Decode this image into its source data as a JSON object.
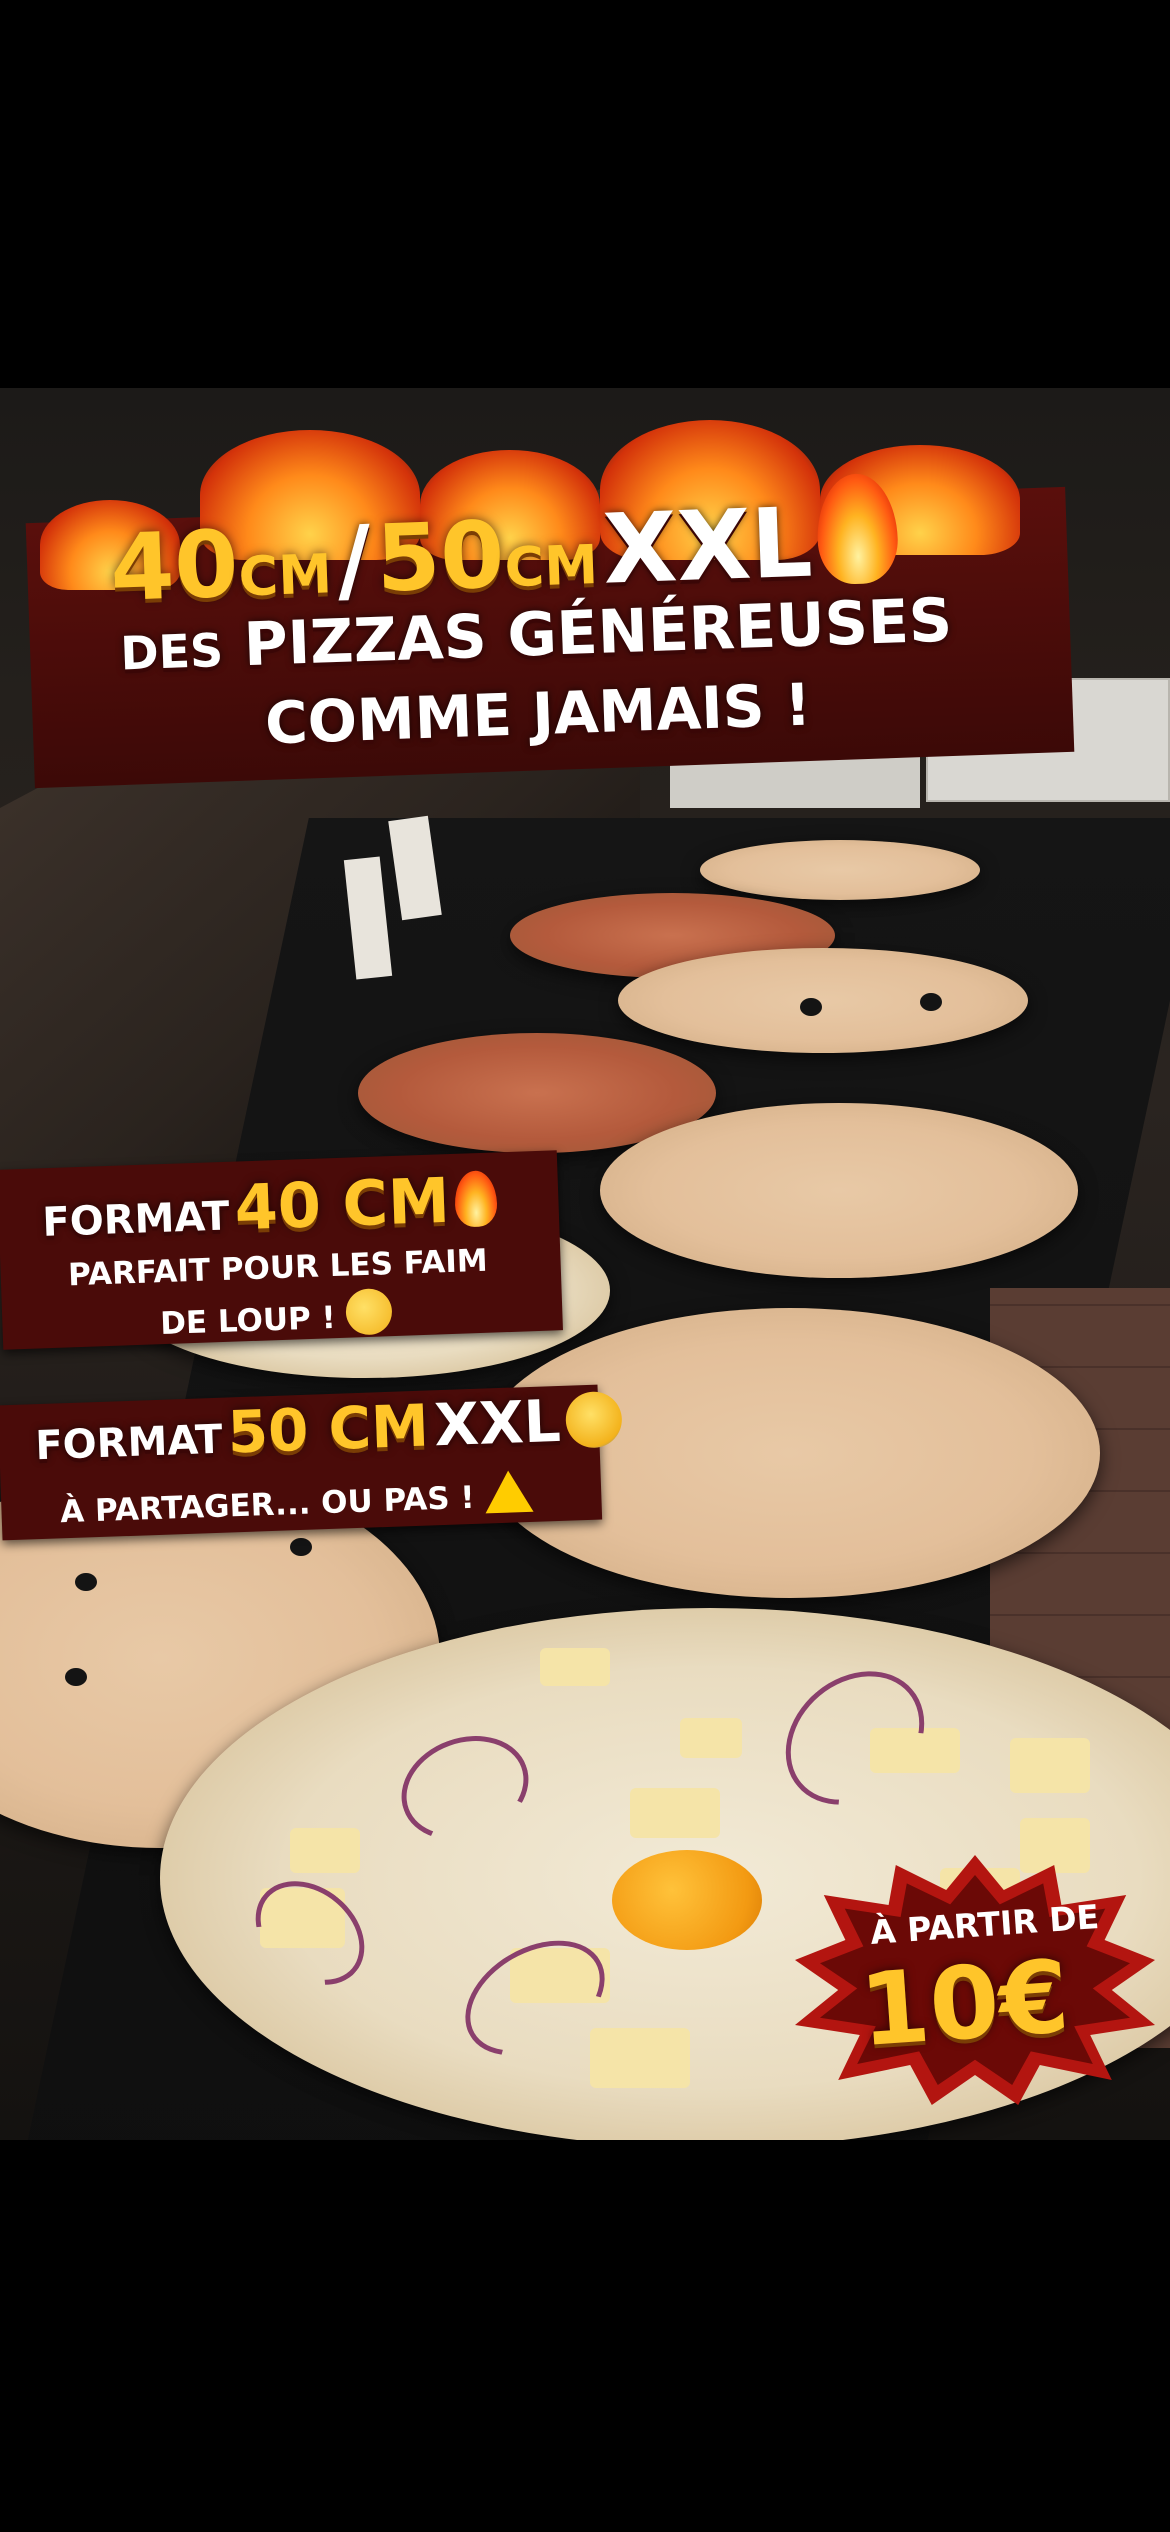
{
  "headline": {
    "size1_value": "40",
    "size1_unit": "CM",
    "separator": "/",
    "size2_value": "50",
    "size2_unit": "CM",
    "size2_suffix": "XXL",
    "line2_prefix": "DES",
    "line2_main": "PIZZAS GÉNÉREUSES",
    "line3": "COMME JAMAIS !"
  },
  "format_40": {
    "label": "FORMAT",
    "size": "40 CM",
    "subtitle_line1": "PARFAIT POUR LES FAIM",
    "subtitle_line2": "DE LOUP !"
  },
  "format_50": {
    "label": "FORMAT",
    "size": "50 CM",
    "suffix": "XXL",
    "subtitle_part1": "À PARTAGER...",
    "subtitle_part2": "OU PAS !"
  },
  "price_badge": {
    "prefix": "À PARTIR DE",
    "price": "10€"
  },
  "colors": {
    "gold": "#ffc52a",
    "banner_red": "#4a0b09",
    "badge_red": "#b31510"
  },
  "icons": [
    "fire-icon",
    "smiling-face-icon",
    "shocked-face-icon",
    "warning-icon"
  ]
}
